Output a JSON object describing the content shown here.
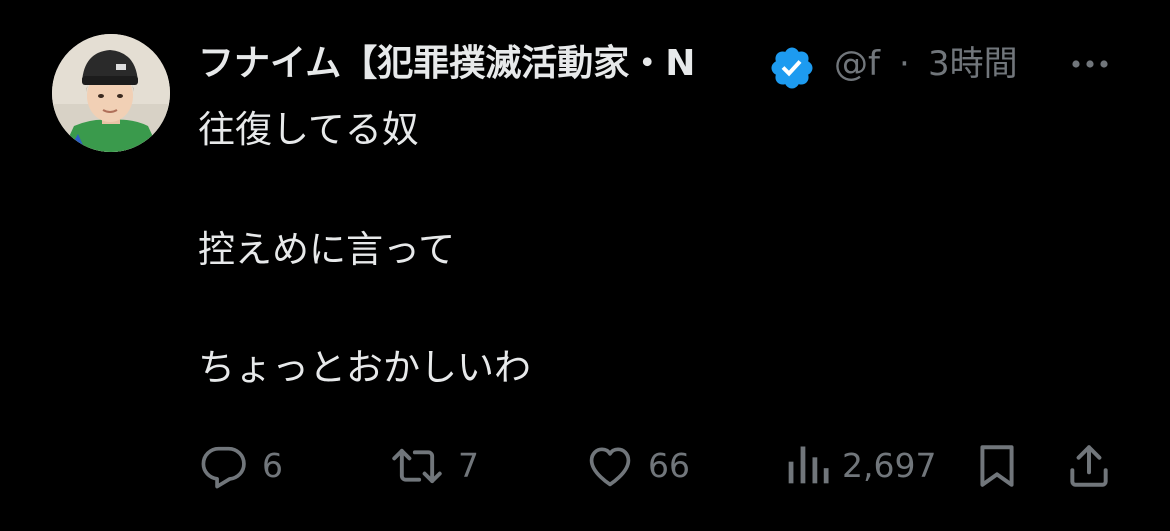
{
  "tweet": {
    "display_name": "フナイム【犯罪撲滅活動家・N",
    "handle": "@f",
    "separator": "·",
    "time": "3時間",
    "verified": true,
    "lines": [
      "往復してる奴",
      "控えめに言って",
      "ちょっとおかしいわ"
    ]
  },
  "actions": {
    "reply_count": "6",
    "retweet_count": "7",
    "like_count": "66",
    "view_count": "2,697"
  },
  "colors": {
    "background": "#000000",
    "text": "#e7e9ea",
    "secondary": "#71767b",
    "verified": "#1d9bf0"
  },
  "icons": [
    "reply-icon",
    "retweet-icon",
    "like-icon",
    "views-icon",
    "bookmark-icon",
    "share-icon",
    "more-icon",
    "verified-badge-icon"
  ]
}
